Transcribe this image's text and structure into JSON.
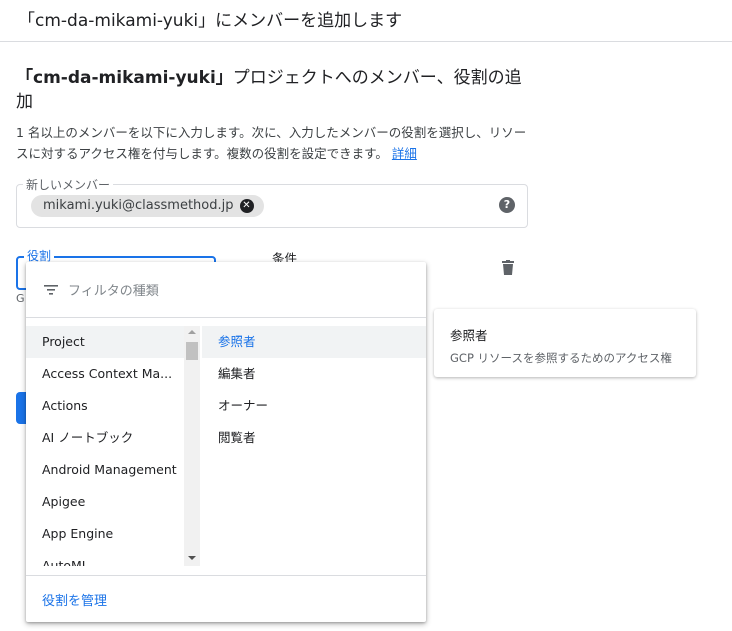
{
  "header": {
    "title": "「cm-da-mikami-yuki」にメンバーを追加します"
  },
  "section": {
    "title_bold": "「cm-da-mikami-yuki」",
    "title_rest": "プロジェクトへのメンバー、役割の追加",
    "description": "1 名以上のメンバーを以下に入力します。次に、入力したメンバーの役割を選択し、リソースに対するアクセス権を付与します。複数の役割を設定できます。",
    "details_link": "詳細"
  },
  "member_field": {
    "label": "新しいメンバー",
    "chips": [
      "mikami.yuki@classmethod.jp"
    ],
    "help_icon": "help-circle-icon"
  },
  "role_field": {
    "label": "役割",
    "hint_fragment": "G"
  },
  "condition": {
    "label": "条件"
  },
  "dropdown": {
    "filter_placeholder": "フィルタの種類",
    "categories": [
      "Project",
      "Access Context Ma...",
      "Actions",
      "AI ノートブック",
      "Android Management",
      "Apigee",
      "App Engine",
      "AutoML"
    ],
    "selected_category": "Project",
    "roles": [
      "参照者",
      "編集者",
      "オーナー",
      "閲覧者"
    ],
    "selected_role": "参照者",
    "manage_link": "役割を管理"
  },
  "tooltip": {
    "title": "参照者",
    "description": "GCP リソースを参照するためのアクセス権"
  },
  "colors": {
    "accent": "#1a73e8"
  }
}
